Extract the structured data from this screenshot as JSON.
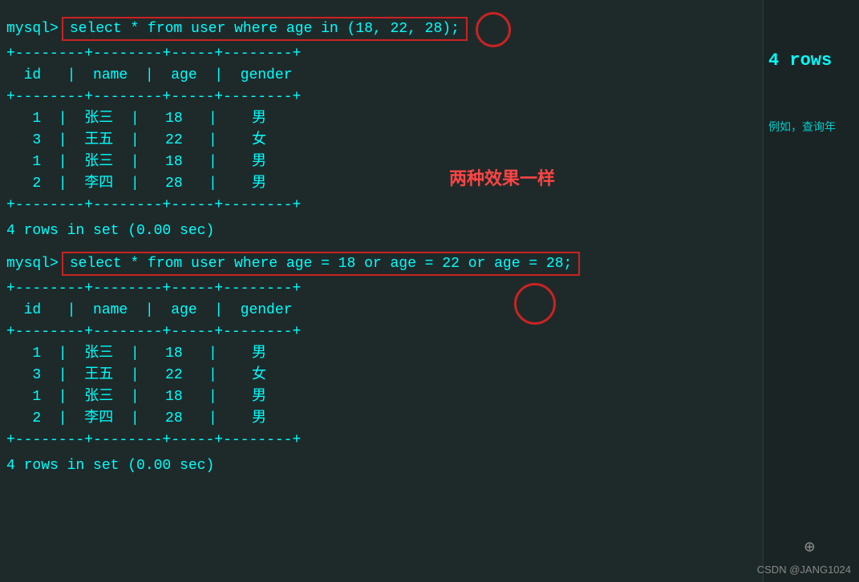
{
  "terminal": {
    "bg_color": "#1e2a2a",
    "text_color": "#00ffff",
    "prompt": "mysql>",
    "query1": {
      "sql": "select * from user where age in (18, 22, 28);",
      "highlighted_word": "in",
      "columns": [
        "id",
        "name",
        "age",
        "gender"
      ],
      "separator": "+--------+--------+--------+--------+",
      "header_row": "  id  |  name  |  age  |  gender  ",
      "rows": [
        {
          "id": "1",
          "name": "张三",
          "age": "18",
          "gender": "男"
        },
        {
          "id": "3",
          "name": "王五",
          "age": "22",
          "gender": "女"
        },
        {
          "id": "1",
          "name": "张三",
          "age": "18",
          "gender": "男"
        },
        {
          "id": "2",
          "name": "李四",
          "age": "28",
          "gender": "男"
        }
      ],
      "result_info": "4 rows in set (0.00 sec)"
    },
    "query2": {
      "sql": "select * from user where age = 18 or age = 22 or age = 28;",
      "highlighted_word": "or",
      "columns": [
        "id",
        "name",
        "age",
        "gender"
      ],
      "rows": [
        {
          "id": "1",
          "name": "张三",
          "age": "18",
          "gender": "男"
        },
        {
          "id": "3",
          "name": "王五",
          "age": "22",
          "gender": "女"
        },
        {
          "id": "1",
          "name": "张三",
          "age": "18",
          "gender": "男"
        },
        {
          "id": "2",
          "name": "李四",
          "age": "28",
          "gender": "男"
        }
      ],
      "result_info": "4 rows in set (0.00 sec)"
    },
    "annotation": "两种效果一样",
    "right_panel": {
      "rows_badge": "4 rows",
      "note": "例如，查询年"
    },
    "csdn_label": "CSDN @JANG1024"
  }
}
